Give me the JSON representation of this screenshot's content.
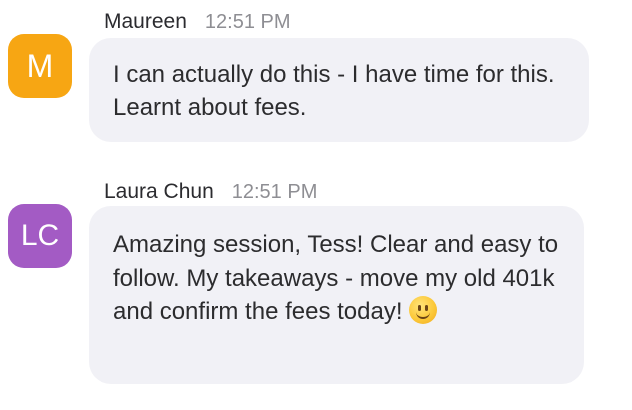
{
  "messages": [
    {
      "sender": "Maureen",
      "time": "12:51 PM",
      "avatar_initials": "M",
      "avatar_color": "#f7a613",
      "text": "I can actually do this - I have time for this. Learnt about fees."
    },
    {
      "sender": "Laura Chun",
      "time": "12:51 PM",
      "avatar_initials": "LC",
      "avatar_color": "#a35bc4",
      "text": "Amazing session, Tess! Clear and easy to follow. My takeaways - move my old 401k and confirm the fees today!",
      "emoji": "slightly-smiling-face-icon"
    }
  ],
  "colors": {
    "bubble_background": "#f1f1f6",
    "timestamp": "#8e8e93",
    "text": "#2c2c2e"
  }
}
